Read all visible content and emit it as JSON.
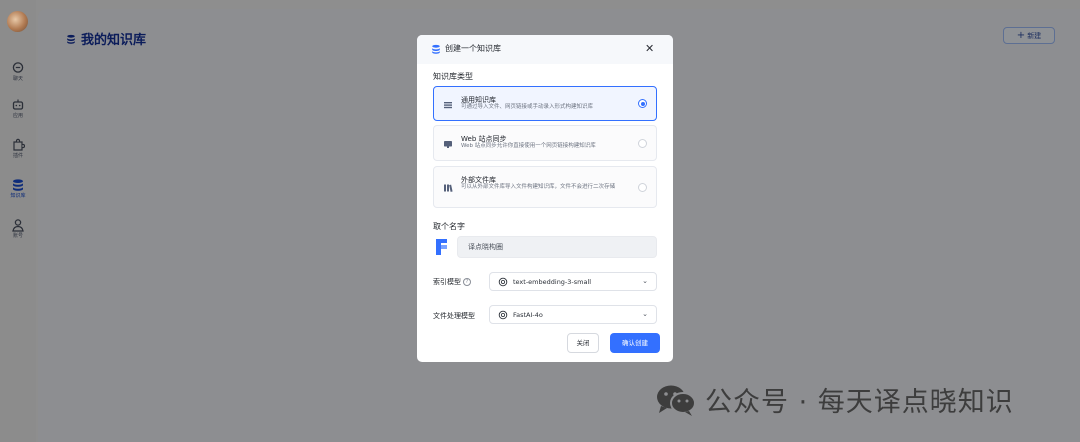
{
  "sidebar": {
    "items": [
      {
        "label": "聊天",
        "icon": "chat-icon"
      },
      {
        "label": "应用",
        "icon": "robot-icon"
      },
      {
        "label": "插件",
        "icon": "puzzle-icon"
      },
      {
        "label": "知识库",
        "icon": "database-icon",
        "active": true
      },
      {
        "label": "账号",
        "icon": "user-icon"
      }
    ]
  },
  "main": {
    "title": "我的知识库",
    "new_button": "新建"
  },
  "modal": {
    "title": "创建一个知识库",
    "type_label": "知识库类型",
    "types": [
      {
        "title": "通用知识库",
        "desc": "可通过导入文件、网页链接或手动录入形式构建知识库",
        "selected": true
      },
      {
        "title": "Web 站点同步",
        "desc": "Web 站点同步允许你直接使用一个网页链接构建知识库",
        "selected": false
      },
      {
        "title": "外部文件库",
        "desc": "可以从外部文件库导入文件构建知识库，文件不会进行二次存储",
        "selected": false
      }
    ],
    "name_label": "取个名字",
    "name_value": "译点晓构圈",
    "index_model_label": "索引模型",
    "index_model_value": "text-embedding-3-small",
    "file_model_label": "文件处理模型",
    "file_model_value": "FastAI-4o",
    "close_button": "关闭",
    "confirm_button": "确认创建"
  },
  "watermark": "公众号 · 每天译点晓知识",
  "colors": {
    "accent": "#3370ff",
    "title_dark": "#0b1c5a"
  }
}
